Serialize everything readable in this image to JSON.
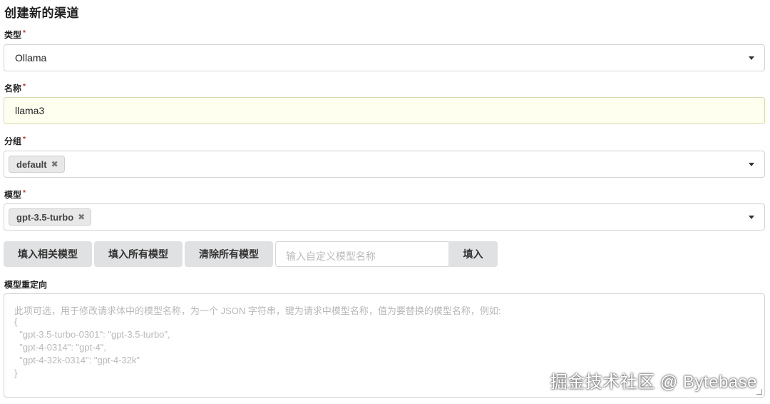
{
  "page": {
    "title": "创建新的渠道"
  },
  "type_field": {
    "label": "类型",
    "required_mark": "*",
    "value": "Ollama"
  },
  "name_field": {
    "label": "名称",
    "required_mark": "*",
    "value": "llama3"
  },
  "group_field": {
    "label": "分组",
    "required_mark": "*",
    "chips": [
      "default"
    ],
    "chip_remove": "✖"
  },
  "model_field": {
    "label": "模型",
    "required_mark": "*",
    "chips": [
      "gpt-3.5-turbo"
    ],
    "chip_remove": "✖"
  },
  "model_buttons": {
    "fill_related": "填入相关模型",
    "fill_all": "填入所有模型",
    "clear_all": "清除所有模型",
    "custom_placeholder": "输入自定义模型名称",
    "fill": "填入"
  },
  "redirect_field": {
    "label": "模型重定向",
    "placeholder_lines": [
      "此项可选，用于修改请求体中的模型名称，为一个 JSON 字符串，键为请求中模型名称，值为要替换的模型名称，例如:",
      "{",
      "  \"gpt-3.5-turbo-0301\": \"gpt-3.5-turbo\",",
      "  \"gpt-4-0314\": \"gpt-4\",",
      "  \"gpt-4-32k-0314\": \"gpt-4-32k\"",
      "}"
    ]
  },
  "watermark": "掘金技术社区 @ Bytebase"
}
